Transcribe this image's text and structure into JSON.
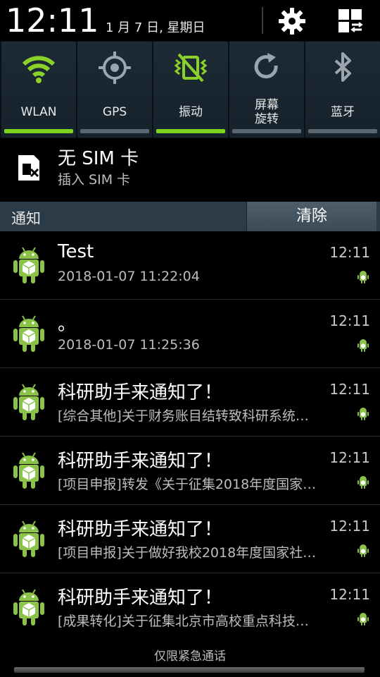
{
  "status_bar": {
    "time": "12:11",
    "date": "1 月 7 日, 星期日",
    "settings_icon": "gear-icon",
    "grid_icon": "grid-switch-icon"
  },
  "quick_toggles": [
    {
      "label": "WLAN",
      "icon": "wifi-icon",
      "active": true
    },
    {
      "label": "GPS",
      "icon": "gps-icon",
      "active": false
    },
    {
      "label": "振动",
      "icon": "vibrate-icon",
      "active": true
    },
    {
      "label": "屏幕\n旋转",
      "label_line1": "屏幕",
      "label_line2": "旋转",
      "icon": "rotate-icon",
      "active": false
    },
    {
      "label": "蓝牙",
      "icon": "bluetooth-icon",
      "active": false
    }
  ],
  "colors": {
    "active_bar": "#7ed321",
    "inactive_bar": "#5a6670",
    "wifi_green": "#8bd12a"
  },
  "sim": {
    "title": "无 SIM 卡",
    "subtitle": "插入 SIM 卡"
  },
  "notifications_header": {
    "label": "通知",
    "clear_label": "清除"
  },
  "notifications": [
    {
      "title": "Test",
      "body": "2018-01-07 11:22:04",
      "time": "12:11"
    },
    {
      "title": "。",
      "body": "2018-01-07 11:25:36",
      "time": "12:11"
    },
    {
      "title": "科研助手来通知了！",
      "body": "[综合其他]关于财务账目结转致科研系统…",
      "time": "12:11"
    },
    {
      "title": "科研助手来通知了！",
      "body": "[项目申报]转发《关于征集2018年度国家…",
      "time": "12:11"
    },
    {
      "title": "科研助手来通知了！",
      "body": "[项目申报]关于做好我校2018年度国家社…",
      "time": "12:11"
    },
    {
      "title": "科研助手来通知了！",
      "body": "[成果转化]关于征集北京市高校重点科技…",
      "time": "12:11"
    }
  ],
  "footer": {
    "emergency_text": "仅限紧急通话"
  }
}
